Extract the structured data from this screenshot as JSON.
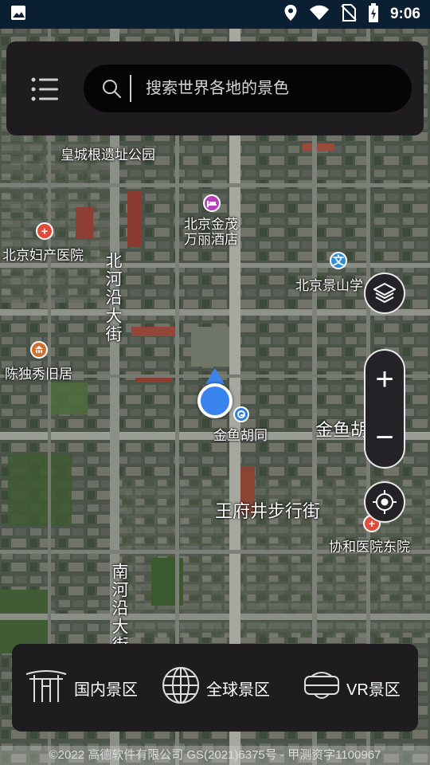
{
  "status_bar": {
    "time": "9:06",
    "icons": [
      "image-icon",
      "location-icon",
      "wifi-icon",
      "no-sim-icon",
      "battery-charging-icon"
    ]
  },
  "search": {
    "placeholder": "搜索世界各地的景色"
  },
  "map": {
    "labels": {
      "huangcheng": "皇城根遗址公园",
      "jinmao": "北京金茂\n万丽酒店",
      "fuchan": "北京妇产医院",
      "beihe": "北河沿大街",
      "jingshan": "北京景山学",
      "chenduxiu": "陈独秀旧居",
      "jinyu_station": "金鱼胡同",
      "jinyu_street": "金鱼胡",
      "wangfujing": "王府井步行街",
      "xiehe": "协和医院东院",
      "nanhe": "南河沿大街"
    }
  },
  "controls": {
    "zoom_in": "+",
    "zoom_out": "−"
  },
  "bottom_nav": {
    "domestic": "国内景区",
    "global": "全球景区",
    "vr": "VR景区"
  },
  "copyright": "©2022 高德软件有限公司 GS(2021)6375号 - 甲测资字1100967"
}
